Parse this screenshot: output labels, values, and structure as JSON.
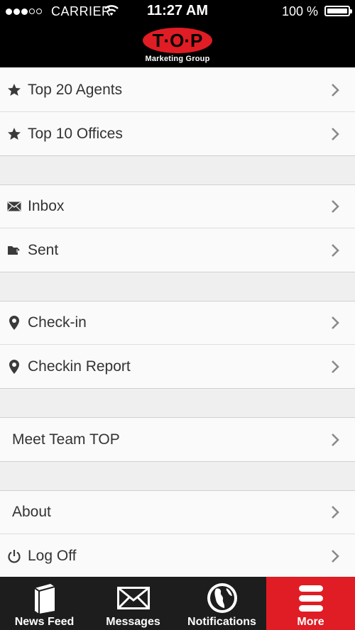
{
  "status_bar": {
    "carrier": "CARRIER",
    "time": "11:27 AM",
    "battery": "100 %"
  },
  "header": {
    "logo_text": "T·O·P",
    "logo_subtitle": "Marketing Group",
    "brand_color": "#e01c24"
  },
  "menu": {
    "group1": [
      {
        "label": "Top 20 Agents",
        "icon": "star-icon"
      },
      {
        "label": "Top 10 Offices",
        "icon": "star-icon"
      }
    ],
    "group2": [
      {
        "label": "Inbox",
        "icon": "envelope-icon"
      },
      {
        "label": "Sent",
        "icon": "sent-folder-icon"
      }
    ],
    "group3": [
      {
        "label": "Check-in",
        "icon": "map-pin-icon"
      },
      {
        "label": "Checkin Report",
        "icon": "map-pin-icon"
      }
    ],
    "group4": [
      {
        "label": "Meet Team TOP",
        "icon": ""
      }
    ],
    "group5": [
      {
        "label": "About",
        "icon": ""
      },
      {
        "label": "Log Off",
        "icon": "power-icon"
      }
    ]
  },
  "tabbar": {
    "tabs": [
      {
        "label": "News Feed",
        "icon": "news-feed-icon"
      },
      {
        "label": "Messages",
        "icon": "envelope-icon"
      },
      {
        "label": "Notifications",
        "icon": "globe-icon"
      },
      {
        "label": "More",
        "icon": "menu-icon"
      }
    ],
    "active_index": 3,
    "active_color": "#e01c24"
  }
}
